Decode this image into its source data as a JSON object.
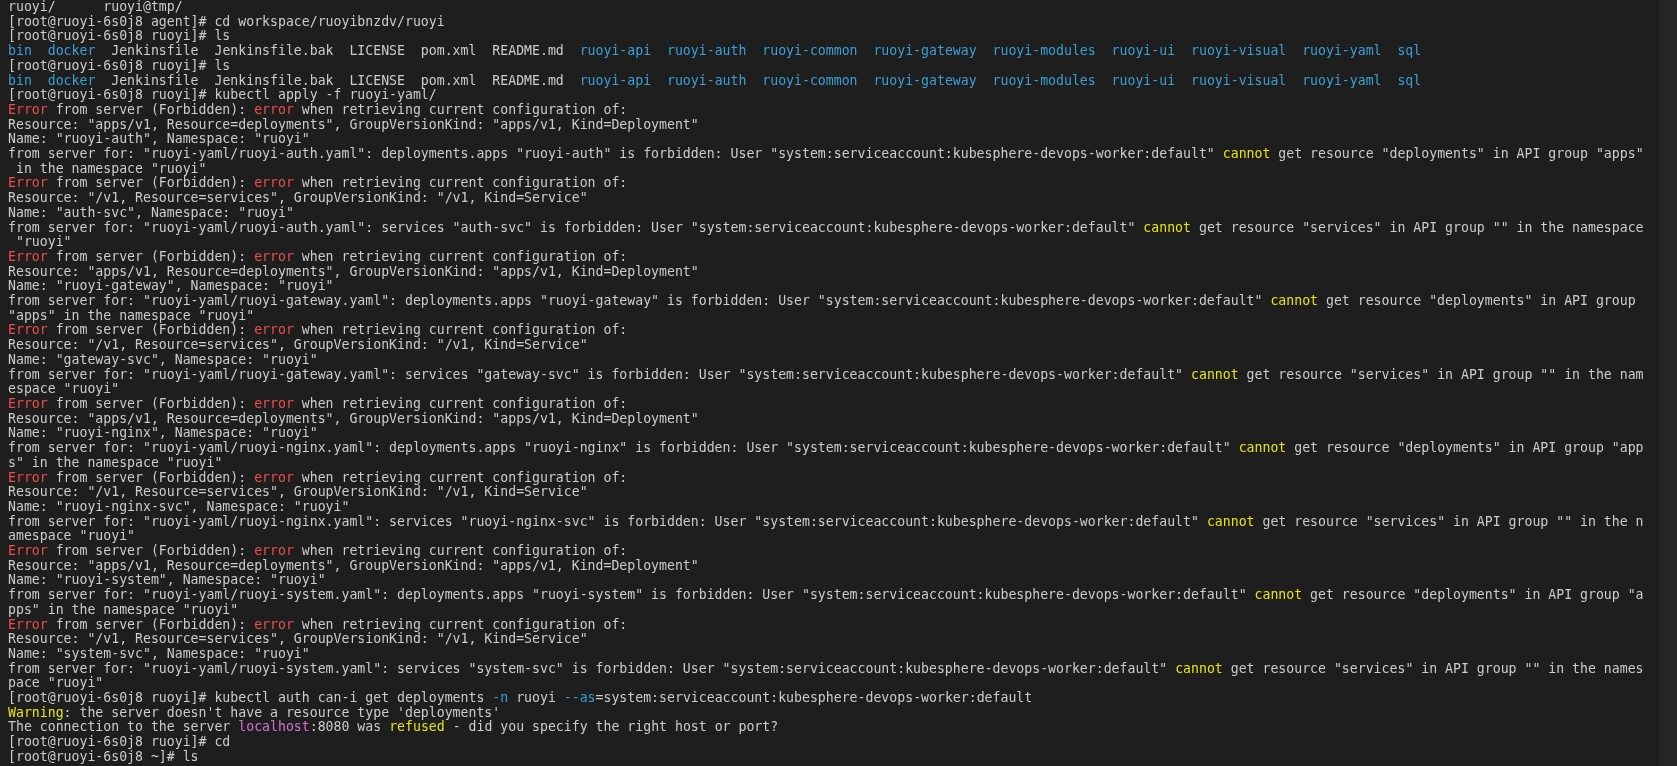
{
  "terminal": {
    "lines": [
      [
        {
          "kind": "plain",
          "text": "ruoyi/      ruoyi@tmp/"
        }
      ],
      [
        {
          "kind": "plain",
          "text": "[root@ruoyi-6s0j8 agent]# cd workspace/ruoyibnzdv/ruoyi"
        }
      ],
      [
        {
          "kind": "plain",
          "text": "[root@ruoyi-6s0j8 ruoyi]# ls"
        }
      ],
      [
        {
          "kind": "dir",
          "text": "bin  docker"
        },
        {
          "kind": "plain",
          "text": "  Jenkinsfile  Jenkinsfile.bak  LICENSE  pom.xml  README.md  "
        },
        {
          "kind": "dir",
          "text": "ruoyi-api  ruoyi-auth  ruoyi-common  ruoyi-gateway  ruoyi-modules  ruoyi-ui  ruoyi-visual  ruoyi-yaml  sql"
        }
      ],
      [
        {
          "kind": "plain",
          "text": "[root@ruoyi-6s0j8 ruoyi]# ls"
        }
      ],
      [
        {
          "kind": "dir",
          "text": "bin  docker"
        },
        {
          "kind": "plain",
          "text": "  Jenkinsfile  Jenkinsfile.bak  LICENSE  pom.xml  README.md  "
        },
        {
          "kind": "dir",
          "text": "ruoyi-api  ruoyi-auth  ruoyi-common  ruoyi-gateway  ruoyi-modules  ruoyi-ui  ruoyi-visual  ruoyi-yaml  sql"
        }
      ],
      [
        {
          "kind": "plain",
          "text": "[root@ruoyi-6s0j8 ruoyi]# kubectl apply -f ruoyi-yaml/"
        }
      ],
      [
        {
          "kind": "error",
          "text": "Error"
        },
        {
          "kind": "plain",
          "text": " from server (Forbidden): "
        },
        {
          "kind": "error",
          "text": "error"
        },
        {
          "kind": "plain",
          "text": " when retrieving current configuration of:"
        }
      ],
      [
        {
          "kind": "plain",
          "text": "Resource: \"apps/v1, Resource=deployments\", GroupVersionKind: \"apps/v1, Kind=Deployment\""
        }
      ],
      [
        {
          "kind": "plain",
          "text": "Name: \"ruoyi-auth\", Namespace: \"ruoyi\""
        }
      ],
      [
        {
          "kind": "plain",
          "text": "from server for: \"ruoyi-yaml/ruoyi-auth.yaml\": deployments.apps \"ruoyi-auth\" is forbidden: User \"system:serviceaccount:kubesphere-devops-worker:default\" "
        },
        {
          "kind": "warn",
          "text": "cannot"
        },
        {
          "kind": "plain",
          "text": " get resource \"deployments\" in API group \"apps\""
        }
      ],
      [
        {
          "kind": "plain",
          "text": " in the namespace \"ruoyi\""
        }
      ],
      [
        {
          "kind": "error",
          "text": "Error"
        },
        {
          "kind": "plain",
          "text": " from server (Forbidden): "
        },
        {
          "kind": "error",
          "text": "error"
        },
        {
          "kind": "plain",
          "text": " when retrieving current configuration of:"
        }
      ],
      [
        {
          "kind": "plain",
          "text": "Resource: \"/v1, Resource=services\", GroupVersionKind: \"/v1, Kind=Service\""
        }
      ],
      [
        {
          "kind": "plain",
          "text": "Name: \"auth-svc\", Namespace: \"ruoyi\""
        }
      ],
      [
        {
          "kind": "plain",
          "text": "from server for: \"ruoyi-yaml/ruoyi-auth.yaml\": services \"auth-svc\" is forbidden: User \"system:serviceaccount:kubesphere-devops-worker:default\" "
        },
        {
          "kind": "warn",
          "text": "cannot"
        },
        {
          "kind": "plain",
          "text": " get resource \"services\" in API group \"\" in the namespace"
        }
      ],
      [
        {
          "kind": "plain",
          "text": " \"ruoyi\""
        }
      ],
      [
        {
          "kind": "error",
          "text": "Error"
        },
        {
          "kind": "plain",
          "text": " from server (Forbidden): "
        },
        {
          "kind": "error",
          "text": "error"
        },
        {
          "kind": "plain",
          "text": " when retrieving current configuration of:"
        }
      ],
      [
        {
          "kind": "plain",
          "text": "Resource: \"apps/v1, Resource=deployments\", GroupVersionKind: \"apps/v1, Kind=Deployment\""
        }
      ],
      [
        {
          "kind": "plain",
          "text": "Name: \"ruoyi-gateway\", Namespace: \"ruoyi\""
        }
      ],
      [
        {
          "kind": "plain",
          "text": "from server for: \"ruoyi-yaml/ruoyi-gateway.yaml\": deployments.apps \"ruoyi-gateway\" is forbidden: User \"system:serviceaccount:kubesphere-devops-worker:default\" "
        },
        {
          "kind": "warn",
          "text": "cannot"
        },
        {
          "kind": "plain",
          "text": " get resource \"deployments\" in API group"
        }
      ],
      [
        {
          "kind": "plain",
          "text": "\"apps\" in the namespace \"ruoyi\""
        }
      ],
      [
        {
          "kind": "error",
          "text": "Error"
        },
        {
          "kind": "plain",
          "text": " from server (Forbidden): "
        },
        {
          "kind": "error",
          "text": "error"
        },
        {
          "kind": "plain",
          "text": " when retrieving current configuration of:"
        }
      ],
      [
        {
          "kind": "plain",
          "text": "Resource: \"/v1, Resource=services\", GroupVersionKind: \"/v1, Kind=Service\""
        }
      ],
      [
        {
          "kind": "plain",
          "text": "Name: \"gateway-svc\", Namespace: \"ruoyi\""
        }
      ],
      [
        {
          "kind": "plain",
          "text": "from server for: \"ruoyi-yaml/ruoyi-gateway.yaml\": services \"gateway-svc\" is forbidden: User \"system:serviceaccount:kubesphere-devops-worker:default\" "
        },
        {
          "kind": "warn",
          "text": "cannot"
        },
        {
          "kind": "plain",
          "text": " get resource \"services\" in API group \"\" in the nam"
        }
      ],
      [
        {
          "kind": "plain",
          "text": "espace \"ruoyi\""
        }
      ],
      [
        {
          "kind": "error",
          "text": "Error"
        },
        {
          "kind": "plain",
          "text": " from server (Forbidden): "
        },
        {
          "kind": "error",
          "text": "error"
        },
        {
          "kind": "plain",
          "text": " when retrieving current configuration of:"
        }
      ],
      [
        {
          "kind": "plain",
          "text": "Resource: \"apps/v1, Resource=deployments\", GroupVersionKind: \"apps/v1, Kind=Deployment\""
        }
      ],
      [
        {
          "kind": "plain",
          "text": "Name: \"ruoyi-nginx\", Namespace: \"ruoyi\""
        }
      ],
      [
        {
          "kind": "plain",
          "text": "from server for: \"ruoyi-yaml/ruoyi-nginx.yaml\": deployments.apps \"ruoyi-nginx\" is forbidden: User \"system:serviceaccount:kubesphere-devops-worker:default\" "
        },
        {
          "kind": "warn",
          "text": "cannot"
        },
        {
          "kind": "plain",
          "text": " get resource \"deployments\" in API group \"app"
        }
      ],
      [
        {
          "kind": "plain",
          "text": "s\" in the namespace \"ruoyi\""
        }
      ],
      [
        {
          "kind": "error",
          "text": "Error"
        },
        {
          "kind": "plain",
          "text": " from server (Forbidden): "
        },
        {
          "kind": "error",
          "text": "error"
        },
        {
          "kind": "plain",
          "text": " when retrieving current configuration of:"
        }
      ],
      [
        {
          "kind": "plain",
          "text": "Resource: \"/v1, Resource=services\", GroupVersionKind: \"/v1, Kind=Service\""
        }
      ],
      [
        {
          "kind": "plain",
          "text": "Name: \"ruoyi-nginx-svc\", Namespace: \"ruoyi\""
        }
      ],
      [
        {
          "kind": "plain",
          "text": "from server for: \"ruoyi-yaml/ruoyi-nginx.yaml\": services \"ruoyi-nginx-svc\" is forbidden: User \"system:serviceaccount:kubesphere-devops-worker:default\" "
        },
        {
          "kind": "warn",
          "text": "cannot"
        },
        {
          "kind": "plain",
          "text": " get resource \"services\" in API group \"\" in the n"
        }
      ],
      [
        {
          "kind": "plain",
          "text": "amespace \"ruoyi\""
        }
      ],
      [
        {
          "kind": "error",
          "text": "Error"
        },
        {
          "kind": "plain",
          "text": " from server (Forbidden): "
        },
        {
          "kind": "error",
          "text": "error"
        },
        {
          "kind": "plain",
          "text": " when retrieving current configuration of:"
        }
      ],
      [
        {
          "kind": "plain",
          "text": "Resource: \"apps/v1, Resource=deployments\", GroupVersionKind: \"apps/v1, Kind=Deployment\""
        }
      ],
      [
        {
          "kind": "plain",
          "text": "Name: \"ruoyi-system\", Namespace: \"ruoyi\""
        }
      ],
      [
        {
          "kind": "plain",
          "text": "from server for: \"ruoyi-yaml/ruoyi-system.yaml\": deployments.apps \"ruoyi-system\" is forbidden: User \"system:serviceaccount:kubesphere-devops-worker:default\" "
        },
        {
          "kind": "warn",
          "text": "cannot"
        },
        {
          "kind": "plain",
          "text": " get resource \"deployments\" in API group \"a"
        }
      ],
      [
        {
          "kind": "plain",
          "text": "pps\" in the namespace \"ruoyi\""
        }
      ],
      [
        {
          "kind": "error",
          "text": "Error"
        },
        {
          "kind": "plain",
          "text": " from server (Forbidden): "
        },
        {
          "kind": "error",
          "text": "error"
        },
        {
          "kind": "plain",
          "text": " when retrieving current configuration of:"
        }
      ],
      [
        {
          "kind": "plain",
          "text": "Resource: \"/v1, Resource=services\", GroupVersionKind: \"/v1, Kind=Service\""
        }
      ],
      [
        {
          "kind": "plain",
          "text": "Name: \"system-svc\", Namespace: \"ruoyi\""
        }
      ],
      [
        {
          "kind": "plain",
          "text": "from server for: \"ruoyi-yaml/ruoyi-system.yaml\": services \"system-svc\" is forbidden: User \"system:serviceaccount:kubesphere-devops-worker:default\" "
        },
        {
          "kind": "warn",
          "text": "cannot"
        },
        {
          "kind": "plain",
          "text": " get resource \"services\" in API group \"\" in the names"
        }
      ],
      [
        {
          "kind": "plain",
          "text": "pace \"ruoyi\""
        }
      ],
      [
        {
          "kind": "plain",
          "text": "[root@ruoyi-6s0j8 ruoyi]# kubectl auth can-i get deployments "
        },
        {
          "kind": "flag",
          "text": "-n"
        },
        {
          "kind": "plain",
          "text": " ruoyi "
        },
        {
          "kind": "flag",
          "text": "--as"
        },
        {
          "kind": "plain",
          "text": "=system:serviceaccount:kubesphere-devops-worker:default"
        }
      ],
      [
        {
          "kind": "warn",
          "text": "Warning"
        },
        {
          "kind": "plain",
          "text": ": the server doesn't have a resource type 'deployments'"
        }
      ],
      [
        {
          "kind": "plain",
          "text": "The connection to the server "
        },
        {
          "kind": "host",
          "text": "localhost"
        },
        {
          "kind": "plain",
          "text": ":8080 was "
        },
        {
          "kind": "warn",
          "text": "refused"
        },
        {
          "kind": "plain",
          "text": " - did you specify the right host or port?"
        }
      ],
      [
        {
          "kind": "plain",
          "text": "[root@ruoyi-6s0j8 ruoyi]# cd"
        }
      ],
      [
        {
          "kind": "plain",
          "text": "[root@ruoyi-6s0j8 ~]# ls"
        }
      ]
    ]
  }
}
